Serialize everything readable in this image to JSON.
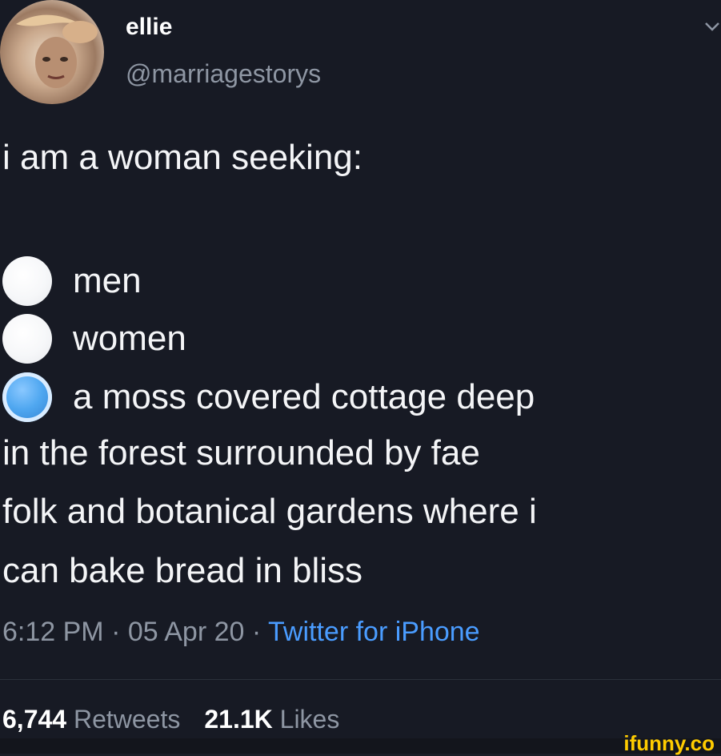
{
  "user": {
    "display_name": "ellie",
    "handle": "@marriagestorys",
    "avatar_icon": "avatar-photo"
  },
  "tweet": {
    "intro": "i am a woman seeking:",
    "options": [
      {
        "label": "men",
        "selected": false
      },
      {
        "label": "women",
        "selected": false
      },
      {
        "label": "a moss covered cottage deep",
        "selected": true
      }
    ],
    "continuation": [
      "in the forest surrounded by fae",
      "folk and botanical gardens where i",
      "can bake bread in bliss"
    ]
  },
  "meta": {
    "time": "6:12 PM",
    "separator1": " · ",
    "date": "05 Apr 20",
    "separator2": " · ",
    "source": "Twitter for iPhone"
  },
  "stats": {
    "retweets_count": "6,744",
    "retweets_label": "Retweets",
    "likes_count": "21.1K",
    "likes_label": "Likes"
  },
  "watermark": {
    "text": "ifunny.co"
  },
  "colors": {
    "background": "#171a24",
    "text": "#f4f5f7",
    "muted": "#8e96a3",
    "link": "#4a9cff",
    "selected_radio": "#4fa7f0",
    "watermark": "#ffcc00"
  }
}
